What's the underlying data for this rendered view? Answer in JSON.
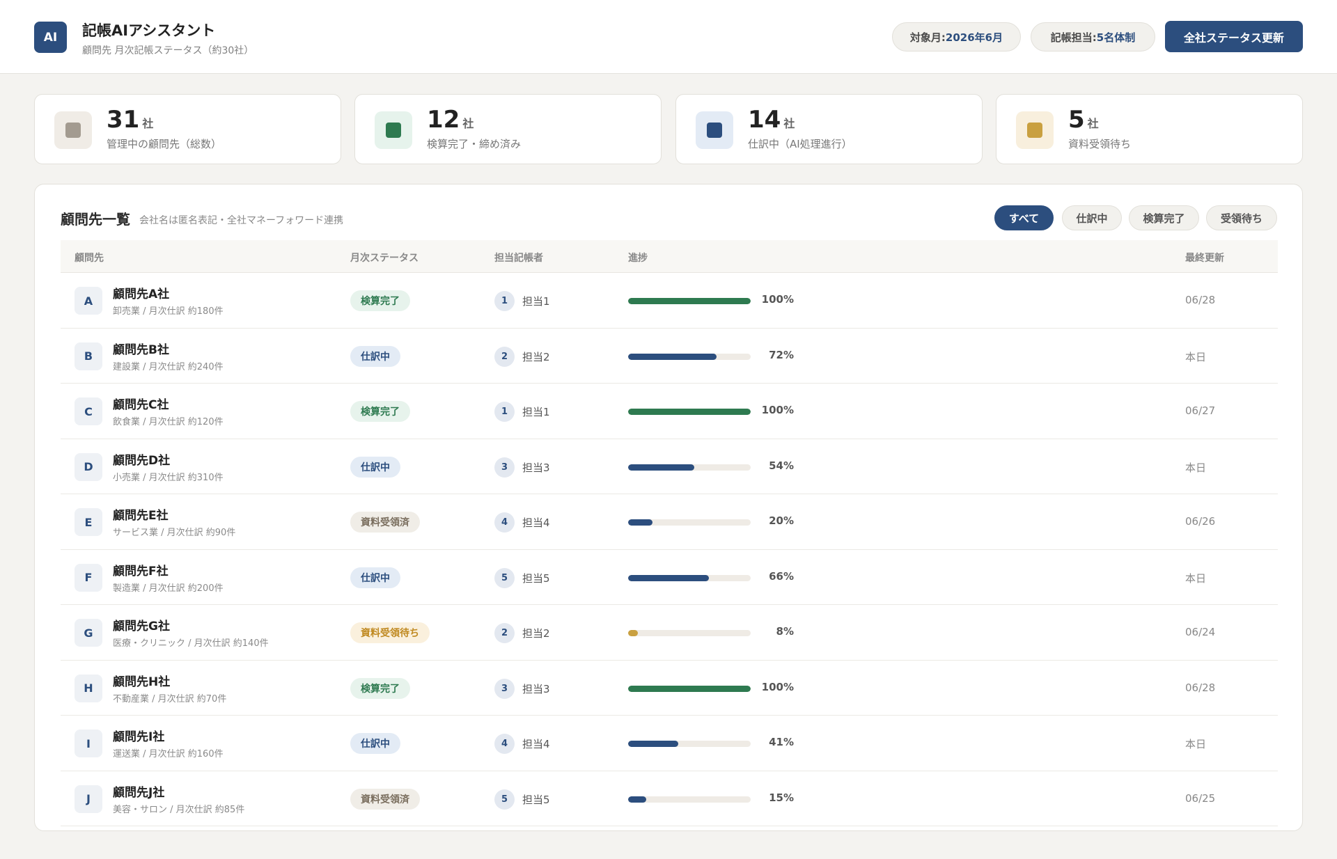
{
  "header": {
    "logo": "AI",
    "title": "記帳AIアシスタント",
    "subtitle": "顧問先 月次記帳ステータス（約30社）",
    "month_label": "対象月: ",
    "month_value": "2026年6月",
    "staff_label": "記帳担当: ",
    "staff_value": "5名体制",
    "refresh_button": "全社ステータス更新"
  },
  "stats": [
    {
      "value": "31",
      "unit": "社",
      "label": "管理中の顧問先（総数）",
      "icon": "total-icon",
      "color": "#a39b90",
      "bg": "#f0ece6"
    },
    {
      "value": "12",
      "unit": "社",
      "label": "検算完了・締め済み",
      "icon": "done-icon",
      "color": "#2e7a50",
      "bg": "#e6f3ec"
    },
    {
      "value": "14",
      "unit": "社",
      "label": "仕訳中（AI処理進行）",
      "icon": "processing-icon",
      "color": "#2c4e7e",
      "bg": "#e3ebf5"
    },
    {
      "value": "5",
      "unit": "社",
      "label": "資料受領待ち",
      "icon": "waiting-icon",
      "color": "#c9a040",
      "bg": "#f8efdd"
    }
  ],
  "panel": {
    "title": "顧問先一覧",
    "subtitle": "会社名は匿名表記・全社マネーフォワード連携",
    "filters": [
      "すべて",
      "仕訳中",
      "検算完了",
      "受領待ち"
    ],
    "columns": {
      "client": "顧問先",
      "status": "月次ステータス",
      "staff": "担当記帳者",
      "progress": "進捗",
      "updated": "最終更新"
    }
  },
  "rows": [
    {
      "letter": "A",
      "name": "顧問先A社",
      "meta": "卸売業 / 月次仕訳 約180件",
      "status": "検算完了",
      "kind": "done",
      "staff_no": "1",
      "staff": "担当1",
      "progress": 100,
      "pct": "100%",
      "updated": "06/28"
    },
    {
      "letter": "B",
      "name": "顧問先B社",
      "meta": "建設業 / 月次仕訳 約240件",
      "status": "仕訳中",
      "kind": "wip",
      "staff_no": "2",
      "staff": "担当2",
      "progress": 72,
      "pct": "72%",
      "updated": "本日"
    },
    {
      "letter": "C",
      "name": "顧問先C社",
      "meta": "飲食業 / 月次仕訳 約120件",
      "status": "検算完了",
      "kind": "done",
      "staff_no": "1",
      "staff": "担当1",
      "progress": 100,
      "pct": "100%",
      "updated": "06/27"
    },
    {
      "letter": "D",
      "name": "顧問先D社",
      "meta": "小売業 / 月次仕訳 約310件",
      "status": "仕訳中",
      "kind": "wip",
      "staff_no": "3",
      "staff": "担当3",
      "progress": 54,
      "pct": "54%",
      "updated": "本日"
    },
    {
      "letter": "E",
      "name": "顧問先E社",
      "meta": "サービス業 / 月次仕訳 約90件",
      "status": "資料受領済",
      "kind": "recv",
      "staff_no": "4",
      "staff": "担当4",
      "progress": 20,
      "pct": "20%",
      "updated": "06/26"
    },
    {
      "letter": "F",
      "name": "顧問先F社",
      "meta": "製造業 / 月次仕訳 約200件",
      "status": "仕訳中",
      "kind": "wip",
      "staff_no": "5",
      "staff": "担当5",
      "progress": 66,
      "pct": "66%",
      "updated": "本日"
    },
    {
      "letter": "G",
      "name": "顧問先G社",
      "meta": "医療・クリニック / 月次仕訳 約140件",
      "status": "資料受領待ち",
      "kind": "wait",
      "staff_no": "2",
      "staff": "担当2",
      "progress": 8,
      "pct": "8%",
      "updated": "06/24"
    },
    {
      "letter": "H",
      "name": "顧問先H社",
      "meta": "不動産業 / 月次仕訳 約70件",
      "status": "検算完了",
      "kind": "done",
      "staff_no": "3",
      "staff": "担当3",
      "progress": 100,
      "pct": "100%",
      "updated": "06/28"
    },
    {
      "letter": "I",
      "name": "顧問先I社",
      "meta": "運送業 / 月次仕訳 約160件",
      "status": "仕訳中",
      "kind": "wip",
      "staff_no": "4",
      "staff": "担当4",
      "progress": 41,
      "pct": "41%",
      "updated": "本日"
    },
    {
      "letter": "J",
      "name": "顧問先J社",
      "meta": "美容・サロン / 月次仕訳 約85件",
      "status": "資料受領済",
      "kind": "recv",
      "staff_no": "5",
      "staff": "担当5",
      "progress": 15,
      "pct": "15%",
      "updated": "06/25"
    }
  ],
  "progress_colors": {
    "done": "#2e7a50",
    "wip": "#2c4e7e",
    "recv": "#2c4e7e",
    "wait": "#c9a040"
  }
}
